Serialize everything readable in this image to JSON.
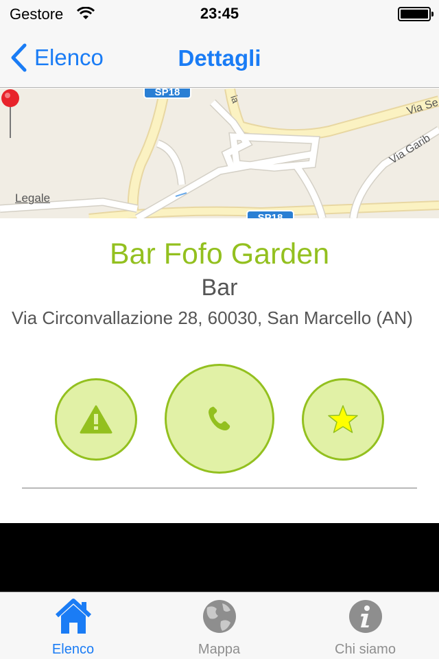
{
  "status_bar": {
    "carrier": "Gestore",
    "time": "23:45",
    "battery_level": 0.95
  },
  "nav": {
    "back_label": "Elenco",
    "title": "Dettagli"
  },
  "map": {
    "legal_label": "Legale",
    "road_labels": {
      "sp_top": "SP18",
      "sp_bottom": "SP18",
      "via_se": "Via Se",
      "via_garib": "Via Garib",
      "via_fragment": "ia"
    }
  },
  "place": {
    "name": "Bar Fofo Garden",
    "category": "Bar",
    "address": "Via Circonvallazione 28, 60030, San Marcello (AN)"
  },
  "actions": {
    "report_icon": "warning-icon",
    "call_icon": "phone-icon",
    "favorite_icon": "star-icon"
  },
  "tabs": [
    {
      "label": "Elenco",
      "icon": "home-icon",
      "active": true
    },
    {
      "label": "Mappa",
      "icon": "globe-icon",
      "active": false
    },
    {
      "label": "Chi siamo",
      "icon": "info-icon",
      "active": false
    }
  ],
  "colors": {
    "accent_blue": "#1a7cf5",
    "brand_green": "#93c01f",
    "button_fill": "#e1f1a6",
    "inactive_gray": "#8e8e8e",
    "star_yellow": "#ffff00"
  }
}
